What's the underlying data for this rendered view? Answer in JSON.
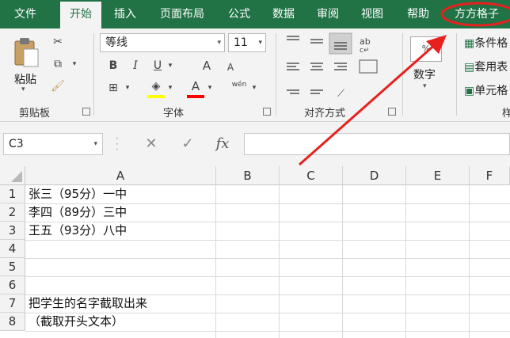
{
  "tabs": [
    "文件",
    "开始",
    "插入",
    "页面布局",
    "公式",
    "数据",
    "审阅",
    "视图",
    "帮助",
    "方方格子"
  ],
  "active_tab": "开始",
  "clipboard": {
    "paste_label": "粘贴",
    "group_label": "剪贴板"
  },
  "font": {
    "name": "等线",
    "size": "11",
    "group_label": "字体",
    "bold": "B",
    "italic": "I",
    "underline": "U",
    "grow": "A",
    "shrink": "A",
    "color_a": "A",
    "phonetic": "wén"
  },
  "alignment": {
    "group_label": "对齐方式"
  },
  "number": {
    "label": "数字"
  },
  "styles": {
    "conditional": "条件格",
    "table": "套用表",
    "cell": "单元格",
    "group_label": "样"
  },
  "formula_bar": {
    "name_box": "C3",
    "cancel": "✕",
    "enter": "✓",
    "fx": "fx"
  },
  "columns": [
    "A",
    "B",
    "C",
    "D",
    "E",
    "F"
  ],
  "rows": [
    {
      "num": "1",
      "a": "张三（95分）一中"
    },
    {
      "num": "2",
      "a": "李四（89分）三中"
    },
    {
      "num": "3",
      "a": "王五（93分）八中"
    },
    {
      "num": "4",
      "a": ""
    },
    {
      "num": "5",
      "a": ""
    },
    {
      "num": "6",
      "a": ""
    },
    {
      "num": "7",
      "a": "把学生的名字截取出来"
    },
    {
      "num": "8",
      "a": "（截取开头文本）"
    }
  ],
  "colors": {
    "ribbon_green": "#217346",
    "annotation_red": "#e8201e",
    "fill_yellow": "#ffff00",
    "font_red": "#ff0000"
  }
}
